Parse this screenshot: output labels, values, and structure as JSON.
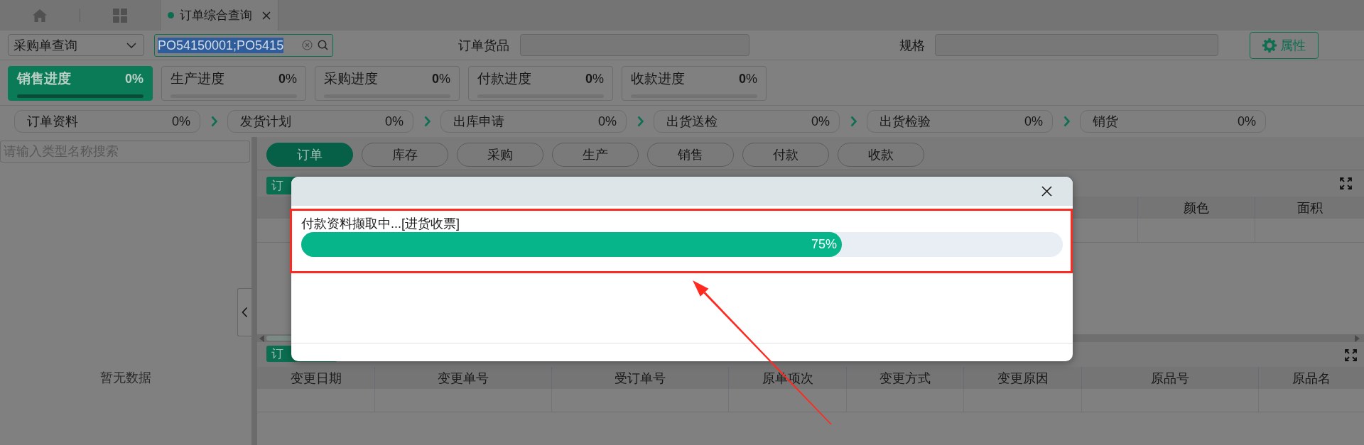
{
  "tab_bar": {
    "tabs": [
      {
        "label": "订单综合查询",
        "selected": true
      }
    ]
  },
  "toolbar": {
    "query_type": "采购单查询",
    "order_search": {
      "value": "PO54150001;PO5415",
      "highlighted": true
    },
    "fields": [
      {
        "label": "订单货品"
      },
      {
        "label": "规格"
      }
    ],
    "properties_button": "属性"
  },
  "progress_cards": [
    {
      "label": "销售进度",
      "reading": "**0**%",
      "selected": true
    },
    {
      "label": "生产进度",
      "reading": "**0**%",
      "selected": false
    },
    {
      "label": "采购进度",
      "reading": "**0**%",
      "selected": false
    },
    {
      "label": "付款进度",
      "reading": "**0**%",
      "selected": false
    },
    {
      "label": "收款进度",
      "reading": "**0**%",
      "selected": false
    }
  ],
  "steps": [
    {
      "label": "订单资料",
      "reading": "0%"
    },
    {
      "label": "发货计划",
      "reading": "0%"
    },
    {
      "label": "出库申请",
      "reading": "0%"
    },
    {
      "label": "出货送检",
      "reading": "0%"
    },
    {
      "label": "出货检验",
      "reading": "0%"
    },
    {
      "label": "销货",
      "reading": "0%"
    }
  ],
  "left_panel": {
    "search": {
      "placeholder": "请输入类型名称搜索"
    },
    "empty_text": "暂无数据"
  },
  "category_tabs": [
    {
      "label": "订单",
      "selected": true
    },
    {
      "label": "库存",
      "selected": false
    },
    {
      "label": "采购",
      "selected": false
    },
    {
      "label": "生产",
      "selected": false
    },
    {
      "label": "销售",
      "selected": false
    },
    {
      "label": "付款",
      "selected": false
    },
    {
      "label": "收款",
      "selected": false
    }
  ],
  "upper_panel": {
    "tag": "订",
    "table": {
      "columns": [
        "颜色",
        "面积"
      ]
    }
  },
  "lower_panel": {
    "tag": "订",
    "table": {
      "columns": [
        "变更日期",
        "变更单号",
        "受订单号",
        "原单项次",
        "变更方式",
        "变更原因",
        "原品号",
        "原品名"
      ]
    }
  },
  "dialog": {
    "message": "付款资料撷取中...[进货收票]",
    "progress": {
      "level": 0.71,
      "reading": "75%"
    }
  }
}
